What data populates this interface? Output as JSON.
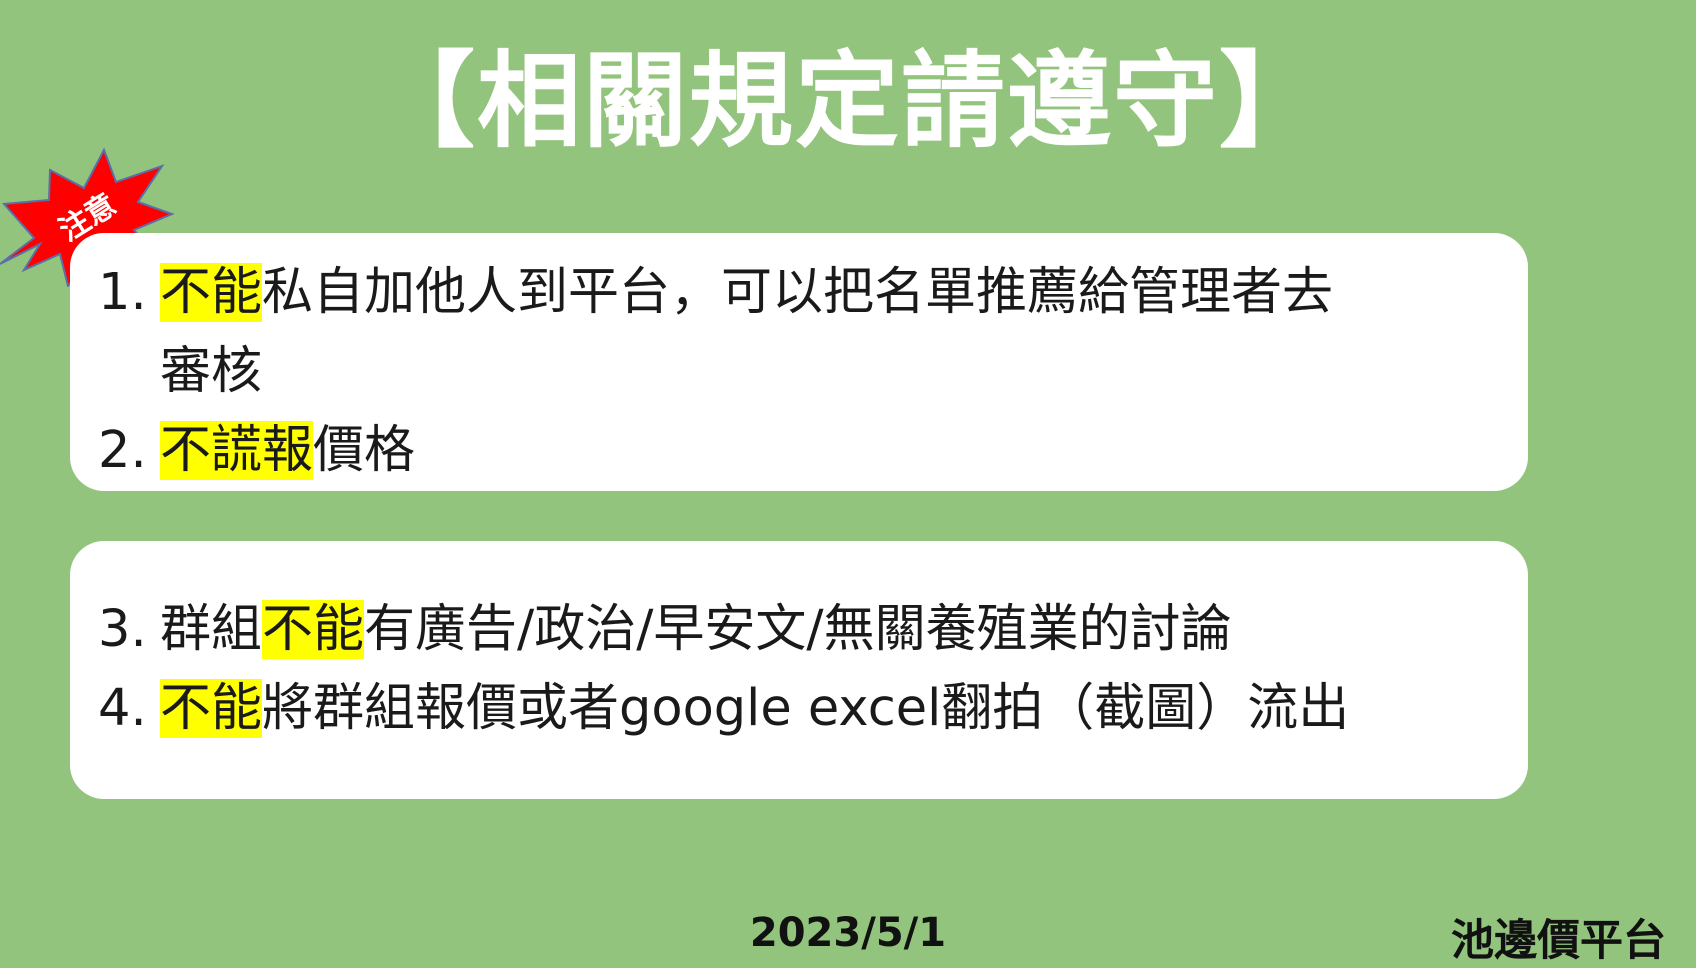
{
  "title": "【相關規定請遵守】",
  "badge": {
    "label": "注意",
    "color": "#ff0000"
  },
  "rules_card_1": [
    {
      "number": "1.",
      "highlight": "不能",
      "line1_rest": "私自加他人到平台，可以把名單推薦給管理者去",
      "line2": "審核"
    },
    {
      "number": "2.",
      "highlight": "不謊報",
      "rest": "價格"
    }
  ],
  "rules_card_2": [
    {
      "number": "3.",
      "before": "群組",
      "highlight": "不能",
      "rest": "有廣告/政治/早安文/無關養殖業的討論"
    },
    {
      "number": "4.",
      "highlight": "不能",
      "rest": "將群組報價或者google excel翻拍（截圖）流出"
    }
  ],
  "footer": {
    "date": "2023/5/1",
    "brand": "池邊價平台"
  },
  "colors": {
    "background": "#93c47d",
    "card": "#ffffff",
    "highlight": "#ffff00",
    "title": "#ffffff"
  }
}
